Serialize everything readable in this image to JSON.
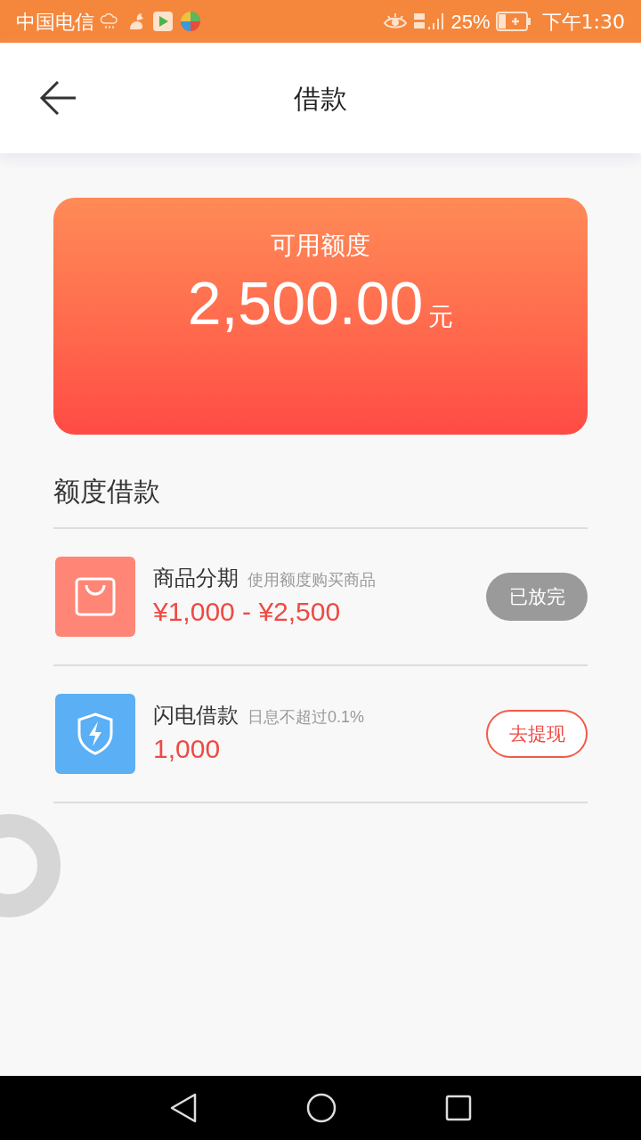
{
  "status_bar": {
    "carrier": "中国电信",
    "battery_percent": "25%",
    "time": "下午1:30"
  },
  "header": {
    "title": "借款"
  },
  "credit_card": {
    "label": "可用额度",
    "amount": "2,500.00",
    "unit": "元"
  },
  "section": {
    "title": "额度借款"
  },
  "products": [
    {
      "name": "商品分期",
      "description": "使用额度购买商品",
      "range": "¥1,000 - ¥2,500",
      "kind": "bag",
      "color": "#ff8676",
      "button": {
        "label": "已放完",
        "disabled": true
      }
    },
    {
      "name": "闪电借款",
      "description": "日息不超过0.1%",
      "range": "1,000",
      "kind": "shield",
      "color": "#5aaff5",
      "button": {
        "label": "去提现",
        "disabled": false
      }
    }
  ]
}
